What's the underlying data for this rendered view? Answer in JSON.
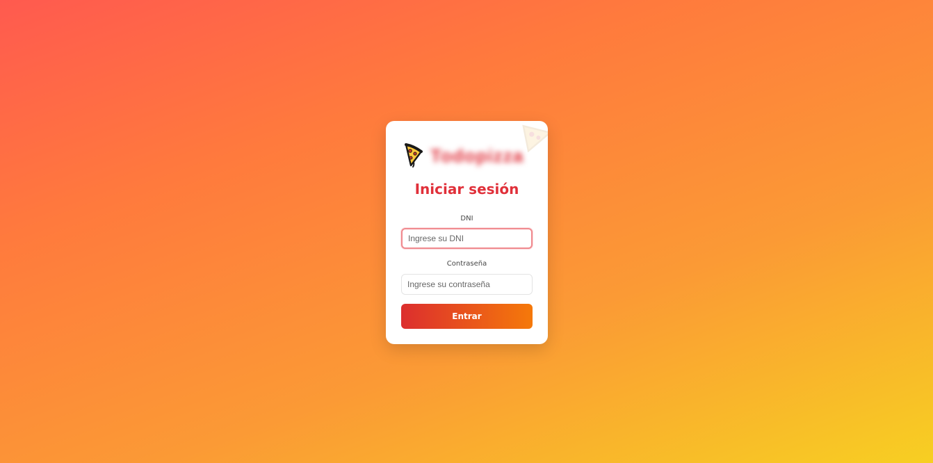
{
  "brand": {
    "name": "Todopizza",
    "icon": "pizza-slice-icon"
  },
  "login": {
    "title": "Iniciar sesión",
    "dni_label": "DNI",
    "dni_placeholder": "Ingrese su DNI",
    "dni_value": "",
    "password_label": "Contraseña",
    "password_placeholder": "Ingrese su contraseña",
    "password_value": "",
    "submit_label": "Entrar"
  },
  "colors": {
    "accent": "#e0303a",
    "button_start": "#dc2e2e",
    "button_end": "#f5790a",
    "background_start": "#ff5a4f",
    "background_end": "#f7cf22"
  }
}
